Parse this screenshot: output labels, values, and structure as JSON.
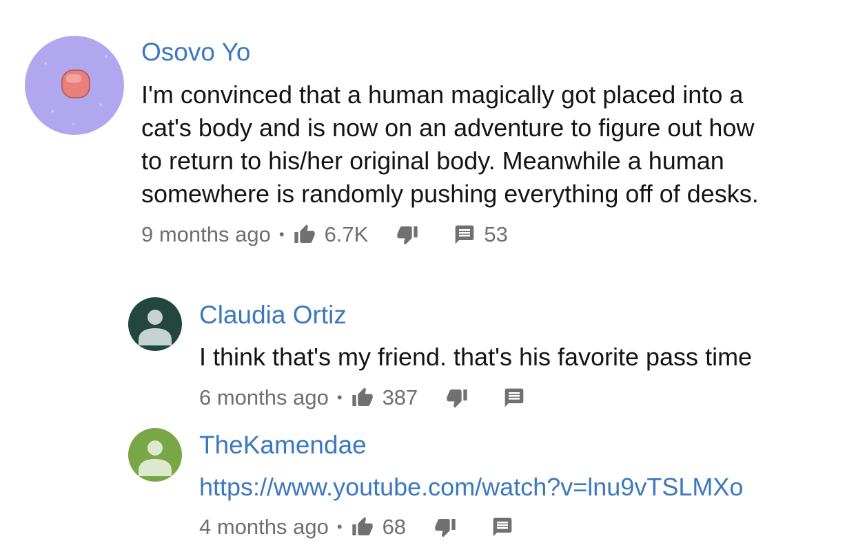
{
  "colors": {
    "link": "#3c78bd",
    "meta": "#6f6f6f",
    "icon": "#707070"
  },
  "comments": [
    {
      "author": "Osovo Yo",
      "avatar": {
        "bg": "#b0a7ee",
        "icon": "pink-blob-avatar"
      },
      "lines": [
        "I'm convinced that a human magically got placed into a",
        "cat's body and is now on an adventure to figure out how",
        "to return to his/her original body. Meanwhile a human",
        "somewhere is randomly pushing everything off of desks."
      ],
      "time": "9 months ago",
      "likes": "6.7K",
      "replies": "53"
    },
    {
      "author": "Claudia Ortiz",
      "avatar": {
        "bg": "#23463f",
        "icon": "person-avatar"
      },
      "lines": [
        "I think that's my friend. that's his favorite pass time"
      ],
      "time": "6 months ago",
      "likes": "387"
    },
    {
      "author": "TheKamendae",
      "avatar": {
        "bg": "#79a646",
        "icon": "person-avatar"
      },
      "link": "https://www.youtube.com/watch?v=lnu9vTSLMXo",
      "time": "4 months ago",
      "likes": "68"
    }
  ],
  "separator": "•"
}
